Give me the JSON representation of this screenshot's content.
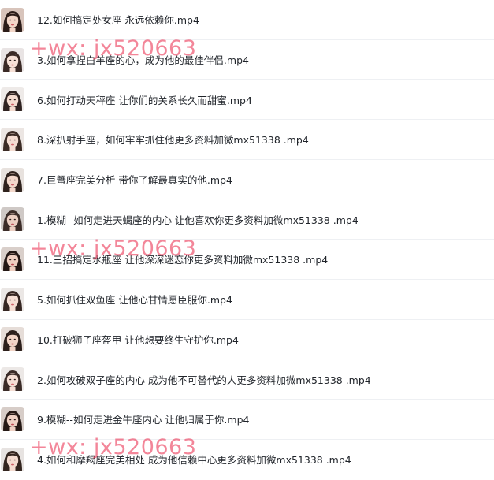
{
  "files": [
    {
      "name": "12.如何搞定处女座 永远依赖你.mp4",
      "thumb": {
        "bg": "#d8c4bb",
        "hair": "#2b1c18",
        "skin": "#f2d6c8",
        "lip": "#c9545c"
      }
    },
    {
      "name": "3.如何拿捏白羊座的心，成为他的最佳伴侣.mp4",
      "thumb": {
        "bg": "#e9e4e4",
        "hair": "#3a2a26",
        "skin": "#f6e0d6",
        "lip": "#d46a72"
      }
    },
    {
      "name": "6.如何打动天秤座 让你们的关系长久而甜蜜.mp4",
      "thumb": {
        "bg": "#eeeae8",
        "hair": "#2e2220",
        "skin": "#f4dbcf",
        "lip": "#cc5d66"
      }
    },
    {
      "name": "8.深扒射手座，如何牢牢抓住他更多资料加微mx51338 .mp4",
      "thumb": {
        "bg": "#ece6e3",
        "hair": "#3b2b25",
        "skin": "#f5ddd2",
        "lip": "#d2646c"
      }
    },
    {
      "name": "7.巨蟹座完美分析 带你了解最真实的他.mp4",
      "thumb": {
        "bg": "#e8e2de",
        "hair": "#2f221d",
        "skin": "#f3d8cb",
        "lip": "#c95a63"
      }
    },
    {
      "name": "1.模糊--如何走进天蝎座的内心 让他喜欢你更多资料加微mx51338 .mp4",
      "thumb": {
        "bg": "#cfc9c6",
        "hair": "#3b2c28",
        "skin": "#eccfc3",
        "lip": "#c05560"
      }
    },
    {
      "name": "11.三招搞定水瓶座 让他深深迷恋你更多资料加微mx51338 .mp4",
      "thumb": {
        "bg": "#d9cfca",
        "hair": "#231714",
        "skin": "#efcfc1",
        "lip": "#b8434e"
      }
    },
    {
      "name": "5.如何抓住双鱼座 让他心甘情愿臣服你.mp4",
      "thumb": {
        "bg": "#ebe7e5",
        "hair": "#352622",
        "skin": "#f6dfd5",
        "lip": "#d0656e"
      }
    },
    {
      "name": "10.打破狮子座盔甲 让他想要终生守护你.mp4",
      "thumb": {
        "bg": "#e6ddd8",
        "hair": "#2c1f1b",
        "skin": "#f2d4c6",
        "lip": "#c44f58"
      }
    },
    {
      "name": "2.如何攻破双子座的内心 成为他不可替代的人更多资料加微mx51338 .mp4",
      "thumb": {
        "bg": "#ece8e6",
        "hair": "#3a2b27",
        "skin": "#f5ded4",
        "lip": "#d3686f"
      }
    },
    {
      "name": "9.模糊--如何走进金牛座内心 让他归属于你.mp4",
      "thumb": {
        "bg": "#d7cdc8",
        "hair": "#251915",
        "skin": "#efd1c4",
        "lip": "#bf4a55"
      }
    },
    {
      "name": "4.如何和摩羯座完美相处 成为他信赖中心更多资料加微mx51338 .mp4",
      "thumb": {
        "bg": "#e7e3e1",
        "hair": "#33251f",
        "skin": "#f4dbd0",
        "lip": "#cd5f68"
      }
    }
  ],
  "watermark": {
    "text": "+wx: jx520663",
    "color": "#ec3c5a"
  }
}
